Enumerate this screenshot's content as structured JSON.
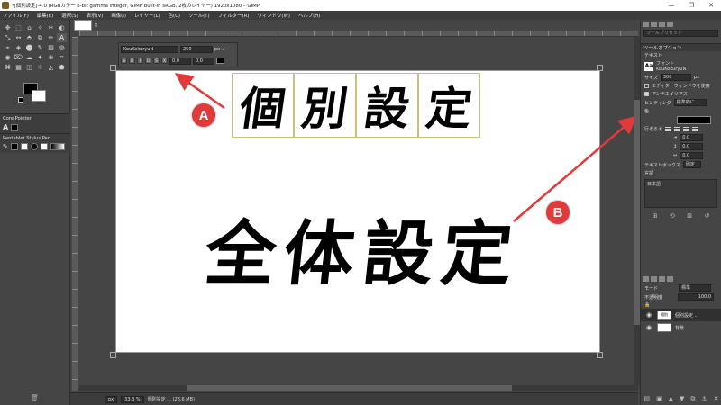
{
  "window": {
    "title": "*[個別設定]-4.0 (RGBカラー 8-bit gamma integer, GIMP built-in sRGB, 2枚のレイヤー) 1920x1080 – GIMP",
    "minimize": "—",
    "maximize": "❐",
    "close": "✕"
  },
  "menu": [
    "ファイル(F)",
    "編集(E)",
    "選択(S)",
    "表示(V)",
    "画像(I)",
    "レイヤー(L)",
    "色(C)",
    "ツール(T)",
    "フィルター(R)",
    "ウィンドウ(W)",
    "ヘルプ(H)"
  ],
  "toolbox": {
    "tools": [
      "✥",
      "⬚",
      "⌂",
      "✧",
      "✂",
      "◐",
      "⤡",
      "↔",
      "⬘",
      "⧉",
      "✏",
      "A",
      "⌖",
      "◈",
      "⬤",
      "✎",
      "▨",
      "◍",
      "◉",
      "⌦",
      "☁",
      "✦",
      "⊕",
      "⌗",
      "⌘",
      "▦",
      "◫",
      "☼",
      "◭",
      "⬟"
    ],
    "active_tool_index": 11,
    "brush_label": "Core Pointer",
    "brush_icon": "A",
    "brush_name": "Pentablet",
    "brush_name2": "Stylus Pen",
    "fg_color": "#000000",
    "bg_color": "#ffffff"
  },
  "canvas": {
    "tiles": [
      "個",
      "別",
      "設",
      "定"
    ],
    "big_text": [
      "全",
      "体",
      "設",
      "定"
    ]
  },
  "text_toolbar": {
    "font": "KouKokuryuN",
    "size": "250",
    "unit": "px",
    "baseline": "0.0",
    "kerning": "0.0",
    "icons": [
      "⟲",
      "B",
      "I",
      "U",
      "S",
      "X"
    ]
  },
  "annotations": {
    "a_label": "A",
    "b_label": "B",
    "color": "#e03a3a"
  },
  "statusbar": {
    "unit": "px",
    "zoom": "33.3 %",
    "info": "個別設定 ... (23.6 MB)"
  },
  "dock": {
    "filter_placeholder": "ツールプリセット",
    "tool_options_title": "ツールオプション",
    "section_title": "テキスト",
    "font_label": "フォント",
    "font_value": "KouKokuryuN",
    "size_label": "サイズ",
    "size_value": "300",
    "size_unit": "px",
    "editor_option": "エディターウィンドウを使用",
    "antialias_option": "アンチエイリアス",
    "hinting_label": "ヒンティング",
    "hinting_value": "標準的に",
    "color_label": "色",
    "justify_label": "行そろえ",
    "indent_value": "0.0",
    "line_spacing_value": "0.0",
    "letter_spacing_value": "0.0",
    "box_label": "テキストボックス",
    "box_value": "固定",
    "language_label": "言語",
    "language_value": "日本語",
    "mode_label": "モード",
    "mode_value": "標準",
    "opacity_label": "不透明度",
    "opacity_value": "100.0",
    "layers": [
      {
        "name": "個別設定 ...",
        "thumb": "個別",
        "selected": true
      },
      {
        "name": "背景",
        "thumb": "",
        "selected": false
      }
    ]
  }
}
